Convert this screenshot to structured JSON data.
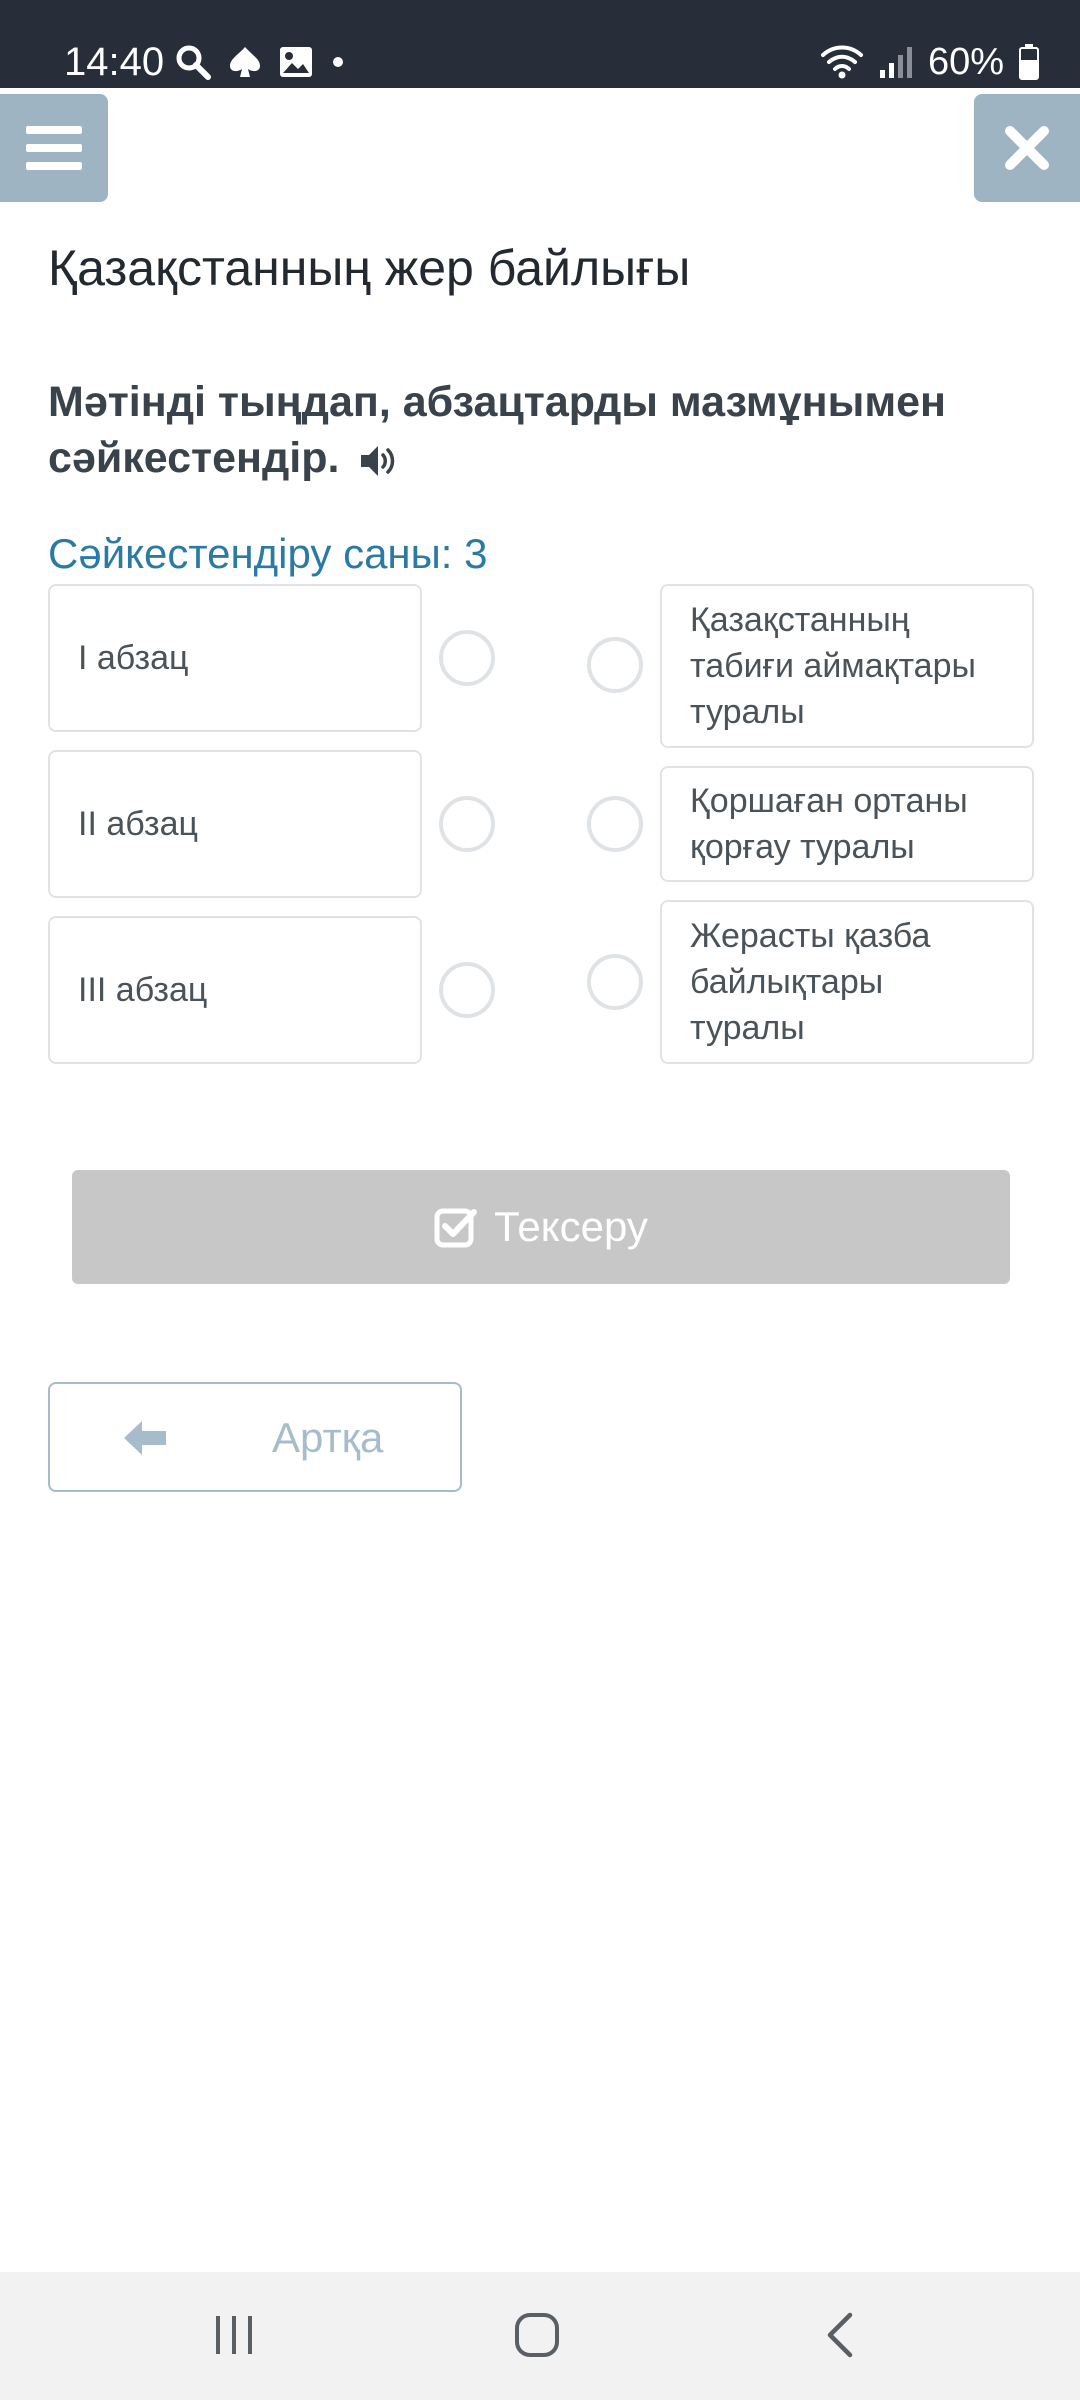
{
  "status_bar": {
    "time": "14:40",
    "battery": "60%",
    "icons": [
      "search-icon",
      "spade-icon",
      "image-icon",
      "dot-icon",
      "wifi-icon",
      "signal-icon",
      "battery-icon"
    ]
  },
  "header": {
    "menu_icon": "hamburger-menu-icon",
    "close_icon": "close-icon"
  },
  "page_title": "Қазақстанның жер байлығы",
  "instruction": "Мәтінді тыңдап, абзацтарды мазмұнымен сәйкестендір.",
  "match_count": "Сәйкестендіру саны: 3",
  "left_items": [
    {
      "label": "I абзац"
    },
    {
      "label": "II абзац"
    },
    {
      "label": "III абзац"
    }
  ],
  "right_items": [
    {
      "label": "Қазақстанның табиғи аймақтары туралы"
    },
    {
      "label": "Қоршаған ортаны қорғау туралы"
    },
    {
      "label": "Жерасты қазба байлықтары туралы"
    }
  ],
  "check_button": {
    "label": "Тексеру",
    "icon": "check-square-icon"
  },
  "back_button": {
    "label": "Артқа",
    "icon": "arrow-left-icon"
  },
  "nav_bar": {
    "items": [
      "recent-apps-icon",
      "home-icon",
      "back-icon"
    ]
  },
  "colors": {
    "status_bar": "#272d39",
    "header_buttons": "#9fb4c3",
    "accent_text": "#2b7aa5",
    "check_button_disabled": "#c7c7c7",
    "back_button_border": "#a7bccb"
  }
}
